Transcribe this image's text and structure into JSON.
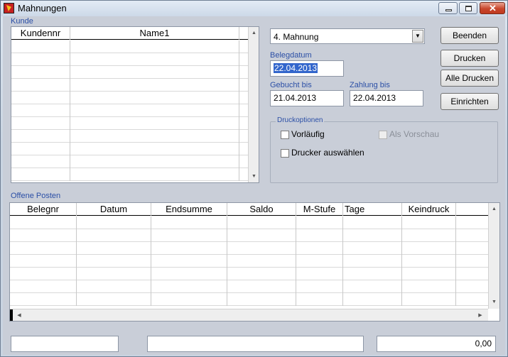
{
  "window": {
    "title": "Mahnungen"
  },
  "kunde": {
    "caption": "Kunde",
    "columns": [
      "Kundennr",
      "Name1"
    ]
  },
  "mahnstufe": {
    "selected": "4. Mahnung"
  },
  "belegdatum": {
    "label": "Belegdatum",
    "value": "22.04.2013"
  },
  "gebucht_bis": {
    "label": "Gebucht bis",
    "value": "21.04.2013"
  },
  "zahlung_bis": {
    "label": "Zahlung bis",
    "value": "22.04.2013"
  },
  "buttons": {
    "beenden": "Beenden",
    "drucken": "Drucken",
    "alle_drucken": "Alle Drucken",
    "einrichten": "Einrichten"
  },
  "druckoptionen": {
    "legend": "Druckoptionen",
    "vorlaeufig": "Vorläufig",
    "als_vorschau": "Als Vorschau",
    "drucker_auswaehlen": "Drucker auswählen"
  },
  "offene_posten": {
    "caption": "Offene Posten",
    "columns": [
      "Belegnr",
      "Datum",
      "Endsumme",
      "Saldo",
      "M-Stufe",
      "Tage",
      "Keindruck"
    ]
  },
  "statusbar": {
    "left": "",
    "middle": "",
    "total": "0,00"
  }
}
